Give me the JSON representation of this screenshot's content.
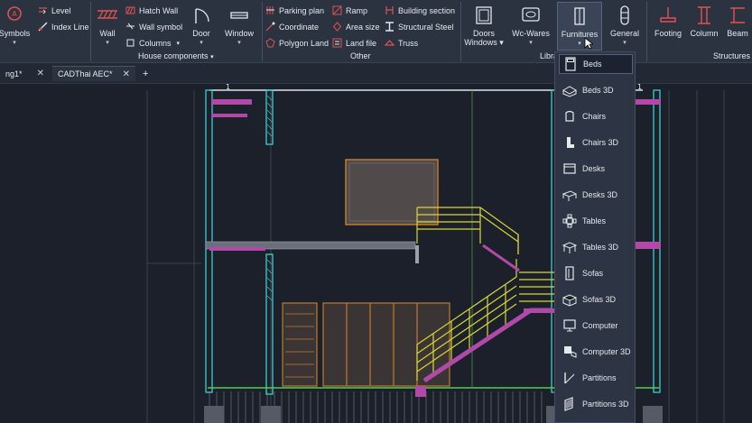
{
  "ribbon": {
    "symbols_label": "Symbols",
    "level_label": "Level",
    "index_line_label": "Index Line",
    "wall_label": "Wall",
    "hatch_wall_label": "Hatch Wall",
    "wall_symbol_label": "Wall symbol",
    "columns_label": "Columns",
    "door_label": "Door",
    "window_label": "Window",
    "house_components_label": "House components",
    "parking_plan_label": "Parking plan",
    "coordinate_label": "Coordinate",
    "polygon_land_label": "Polygon Land",
    "ramp_label": "Ramp",
    "area_size_label": "Area size",
    "land_file_label": "Land file",
    "building_section_label": "Building section",
    "structural_steel_label": "Structural Steel",
    "truss_label": "Truss",
    "other_label": "Other",
    "doors_windows_label_1": "Doors",
    "doors_windows_label_2": "Windows",
    "wc_wares_label": "Wc-Wares",
    "furnitures_label": "Furnitures",
    "general_label": "General",
    "library_label_partial": "Libra",
    "footing_label": "Footing",
    "column_label": "Column",
    "beam_label": "Beam",
    "structures_label": "Structures"
  },
  "tabs": [
    {
      "label": "ng1*"
    },
    {
      "label": "CADThai AEC*"
    }
  ],
  "drawing": {
    "level_marker_left": "1",
    "level_marker_right": "1"
  },
  "dropdown": {
    "items": [
      {
        "label": "Beds",
        "icon": "bed-icon",
        "selected": true
      },
      {
        "label": "Beds  3D",
        "icon": "bed-3d-icon"
      },
      {
        "label": "Chairs",
        "icon": "chair-icon"
      },
      {
        "label": "Chairs  3D",
        "icon": "chair-3d-icon"
      },
      {
        "label": "Desks",
        "icon": "desk-icon"
      },
      {
        "label": "Desks  3D",
        "icon": "desk-3d-icon"
      },
      {
        "label": "Tables",
        "icon": "table-icon"
      },
      {
        "label": "Tables  3D",
        "icon": "table-3d-icon"
      },
      {
        "label": "Sofas",
        "icon": "sofa-icon"
      },
      {
        "label": "Sofas  3D",
        "icon": "sofa-3d-icon"
      },
      {
        "label": "Computer",
        "icon": "computer-icon"
      },
      {
        "label": "Computer  3D",
        "icon": "computer-3d-icon"
      },
      {
        "label": "Partitions",
        "icon": "partition-icon"
      },
      {
        "label": "Partitions  3D",
        "icon": "partition-3d-icon"
      }
    ]
  },
  "colors": {
    "ribbon_bg": "#2b3341",
    "canvas_bg": "#1b202b",
    "wall_cyan": "#3ecfcf",
    "slab_magenta": "#b04aa8",
    "stair_yellow": "#d9d633",
    "door_orange": "#c07a2c"
  }
}
